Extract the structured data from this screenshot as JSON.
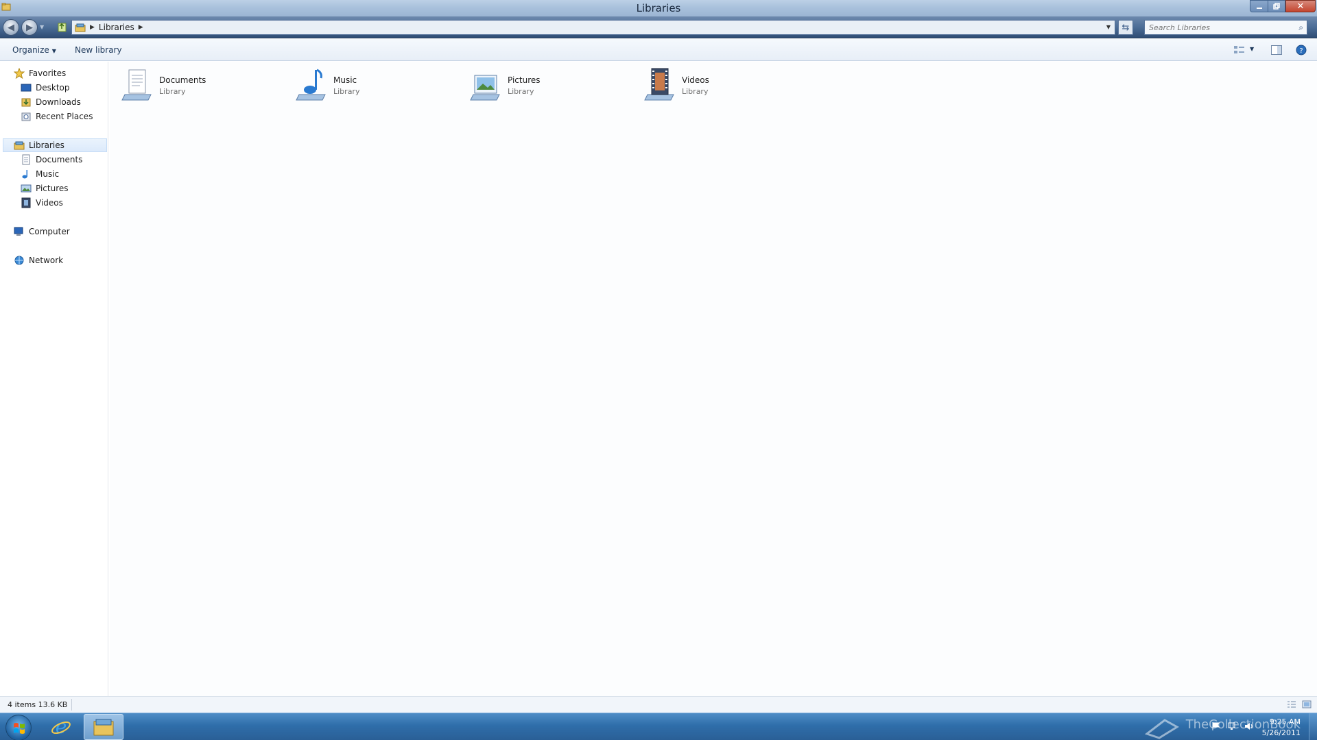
{
  "window": {
    "title": "Libraries"
  },
  "address": {
    "crumbs": [
      "Libraries"
    ],
    "search_placeholder": "Search Libraries"
  },
  "commands": {
    "organize": "Organize",
    "new_library": "New library"
  },
  "nav": {
    "favorites": {
      "label": "Favorites",
      "items": [
        "Desktop",
        "Downloads",
        "Recent Places"
      ]
    },
    "libraries": {
      "label": "Libraries",
      "items": [
        "Documents",
        "Music",
        "Pictures",
        "Videos"
      ]
    },
    "computer": "Computer",
    "network": "Network"
  },
  "libraries": [
    {
      "name": "Documents",
      "type": "Library",
      "icon": "documents-library-icon"
    },
    {
      "name": "Music",
      "type": "Library",
      "icon": "music-library-icon"
    },
    {
      "name": "Pictures",
      "type": "Library",
      "icon": "pictures-library-icon"
    },
    {
      "name": "Videos",
      "type": "Library",
      "icon": "videos-library-icon"
    }
  ],
  "status": {
    "text": "4 items  13.6 KB"
  },
  "taskbar": {
    "time": "9:25 AM",
    "date": "5/26/2011",
    "watermark": "TheCollectionBook"
  },
  "colors": {
    "accent": "#2f6eaa",
    "titlebar": "#a9c1dc",
    "address_bar": "#4c6d97"
  }
}
